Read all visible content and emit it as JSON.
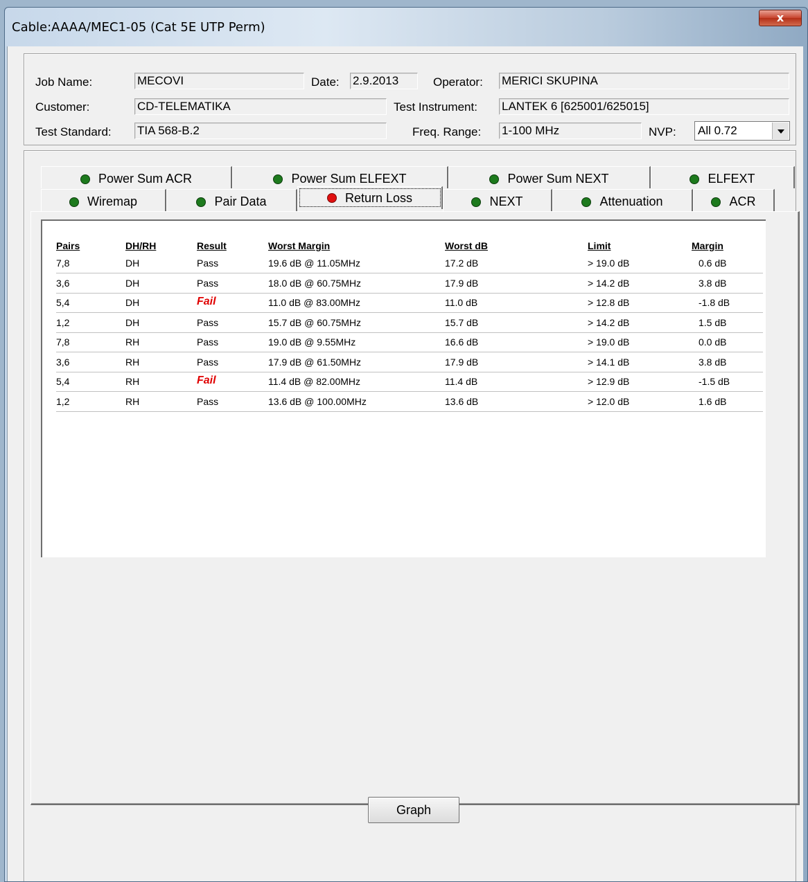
{
  "window": {
    "title": "Cable:AAAA/MEC1-05 (Cat 5E UTP Perm)",
    "close_label": "x"
  },
  "header": {
    "job_name_label": "Job Name:",
    "job_name": "MECOVI",
    "date_label": "Date:",
    "date": "2.9.2013",
    "operator_label": "Operator:",
    "operator": "MERICI SKUPINA",
    "customer_label": "Customer:",
    "customer": "CD-TELEMATIKA",
    "instrument_label": "Test Instrument:",
    "instrument": "LANTEK 6 [625001/625015]",
    "standard_label": "Test Standard:",
    "standard": "TIA 568-B.2",
    "freq_label": "Freq. Range:",
    "freq": "1-100 MHz",
    "nvp_label": "NVP:",
    "nvp": "All 0.72"
  },
  "tabs_row1": [
    {
      "label": "Power Sum ACR",
      "status": "pass"
    },
    {
      "label": "Power Sum ELFEXT",
      "status": "pass"
    },
    {
      "label": "Power Sum NEXT",
      "status": "pass"
    },
    {
      "label": "ELFEXT",
      "status": "pass"
    }
  ],
  "tabs_row2": [
    {
      "label": "Wiremap",
      "status": "pass"
    },
    {
      "label": "Pair Data",
      "status": "pass"
    },
    {
      "label": "Return Loss",
      "status": "fail"
    },
    {
      "label": "NEXT",
      "status": "pass"
    },
    {
      "label": "Attenuation",
      "status": "pass"
    },
    {
      "label": "ACR",
      "status": "pass"
    }
  ],
  "table": {
    "columns": [
      "Pairs",
      "DH/RH",
      "Result",
      "Worst Margin",
      "Worst dB",
      "Limit",
      "Margin"
    ],
    "rows": [
      [
        "7,8",
        "DH",
        "Pass",
        "19.6 dB @ 11.05MHz",
        "17.2 dB",
        "> 19.0 dB",
        "0.6 dB"
      ],
      [
        "3,6",
        "DH",
        "Pass",
        "18.0 dB @ 60.75MHz",
        "17.9 dB",
        "> 14.2 dB",
        "3.8 dB"
      ],
      [
        "5,4",
        "DH",
        "Fail",
        "11.0 dB @ 83.00MHz",
        "11.0 dB",
        "> 12.8 dB",
        "-1.8 dB"
      ],
      [
        "1,2",
        "DH",
        "Pass",
        "15.7 dB @ 60.75MHz",
        "15.7 dB",
        "> 14.2 dB",
        "1.5 dB"
      ],
      [
        "7,8",
        "RH",
        "Pass",
        "19.0 dB @  9.55MHz",
        "16.6 dB",
        "> 19.0 dB",
        "0.0 dB"
      ],
      [
        "3,6",
        "RH",
        "Pass",
        "17.9 dB @ 61.50MHz",
        "17.9 dB",
        "> 14.1 dB",
        "3.8 dB"
      ],
      [
        "5,4",
        "RH",
        "Fail",
        "11.4 dB @ 82.00MHz",
        "11.4 dB",
        "> 12.9 dB",
        "-1.5 dB"
      ],
      [
        "1,2",
        "RH",
        "Pass",
        "13.6 dB @ 100.00MHz",
        "13.6 dB",
        "> 12.0 dB",
        "1.6 dB"
      ]
    ]
  },
  "buttons": {
    "graph": "Graph"
  },
  "colors": {
    "pass": "#1d7a1d",
    "fail": "#e01010"
  }
}
